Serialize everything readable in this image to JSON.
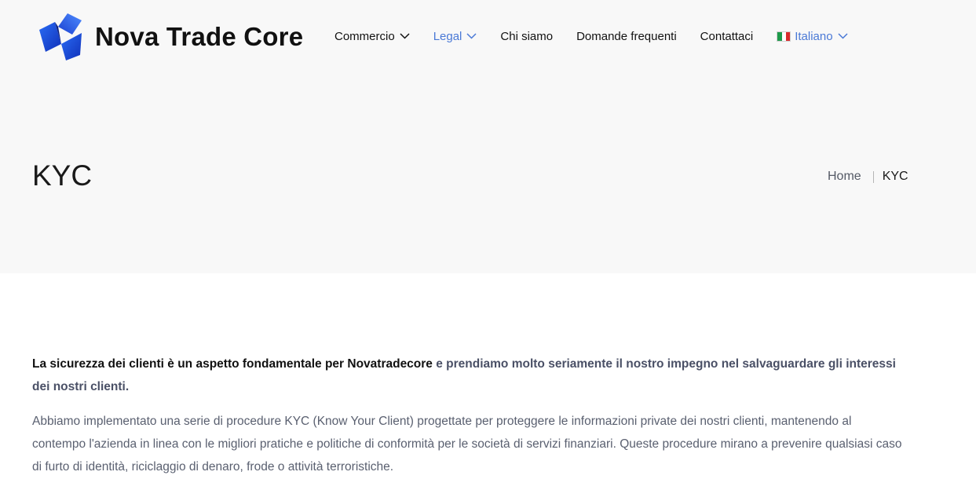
{
  "brand": {
    "name": "Nova Trade Core",
    "logo_icon": "nova-trade-core-logo-icon",
    "colors": {
      "primary": "#1f4fe0",
      "accent": "#4a79d6",
      "hero_bg": "#f8f8f8"
    }
  },
  "nav": {
    "items": [
      {
        "label": "Commercio",
        "has_dropdown": true,
        "active": false
      },
      {
        "label": "Legal",
        "has_dropdown": true,
        "active": true
      },
      {
        "label": "Chi siamo",
        "has_dropdown": false,
        "active": false
      },
      {
        "label": "Domande frequenti",
        "has_dropdown": false,
        "active": false
      },
      {
        "label": "Contattaci",
        "has_dropdown": false,
        "active": false
      }
    ],
    "language": {
      "label": "Italiano",
      "flag_icon": "italy-flag-icon"
    }
  },
  "hero": {
    "title": "KYC",
    "breadcrumb": {
      "home": "Home",
      "current": "KYC"
    }
  },
  "content": {
    "lead_strong": "La sicurezza dei clienti è un aspetto fondamentale per Novatradecore",
    "lead_rest": " e prendiamo molto seriamente il nostro impegno nel salvaguardare gli interessi dei nostri clienti.",
    "paragraph": "Abbiamo implementato una serie di procedure KYC (Know Your Client) progettate per proteggere le informazioni private dei nostri clienti, mantenendo al contempo l'azienda in linea con le migliori pratiche e politiche di conformità per le società di servizi finanziari. Queste procedure mirano a prevenire qualsiasi caso di furto di identità, riciclaggio di denaro, frode o attività terroristiche."
  }
}
